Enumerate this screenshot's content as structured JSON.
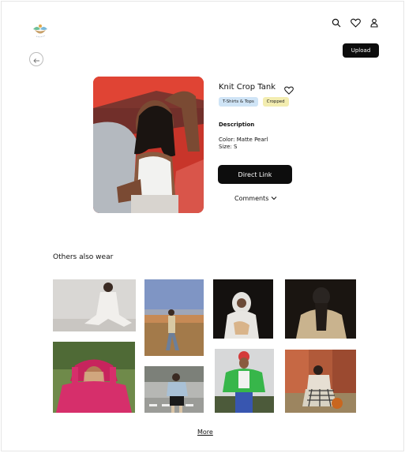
{
  "header": {
    "logo_icon": "plant-logo-icon",
    "icons": [
      "search-icon",
      "heart-icon",
      "user-icon"
    ],
    "upload_label": "Upload"
  },
  "nav": {
    "back_icon": "arrow-left-icon"
  },
  "product": {
    "title": "Knit Crop Tank",
    "tags": [
      "T-Shirts & Tops",
      "Cropped"
    ],
    "description_heading": "Description",
    "color_line": "Color: Matte Pearl",
    "size_line": "Size: S",
    "direct_link_label": "Direct Link",
    "comments_label": "Comments"
  },
  "others": {
    "heading": "Others also wear",
    "items": [
      "white-knit-outfit-photo",
      "field-sunset-photo",
      "white-puffer-night-photo",
      "beige-coat-night-photo",
      "pink-puffer-photo",
      "street-denim-photo",
      "green-puffer-photo",
      "plaid-pants-photo"
    ],
    "more_label": "More"
  },
  "colors": {
    "accent": "#0d0d0d",
    "tag_blue": "#cfe4f6",
    "tag_yellow": "#f3edb0"
  }
}
